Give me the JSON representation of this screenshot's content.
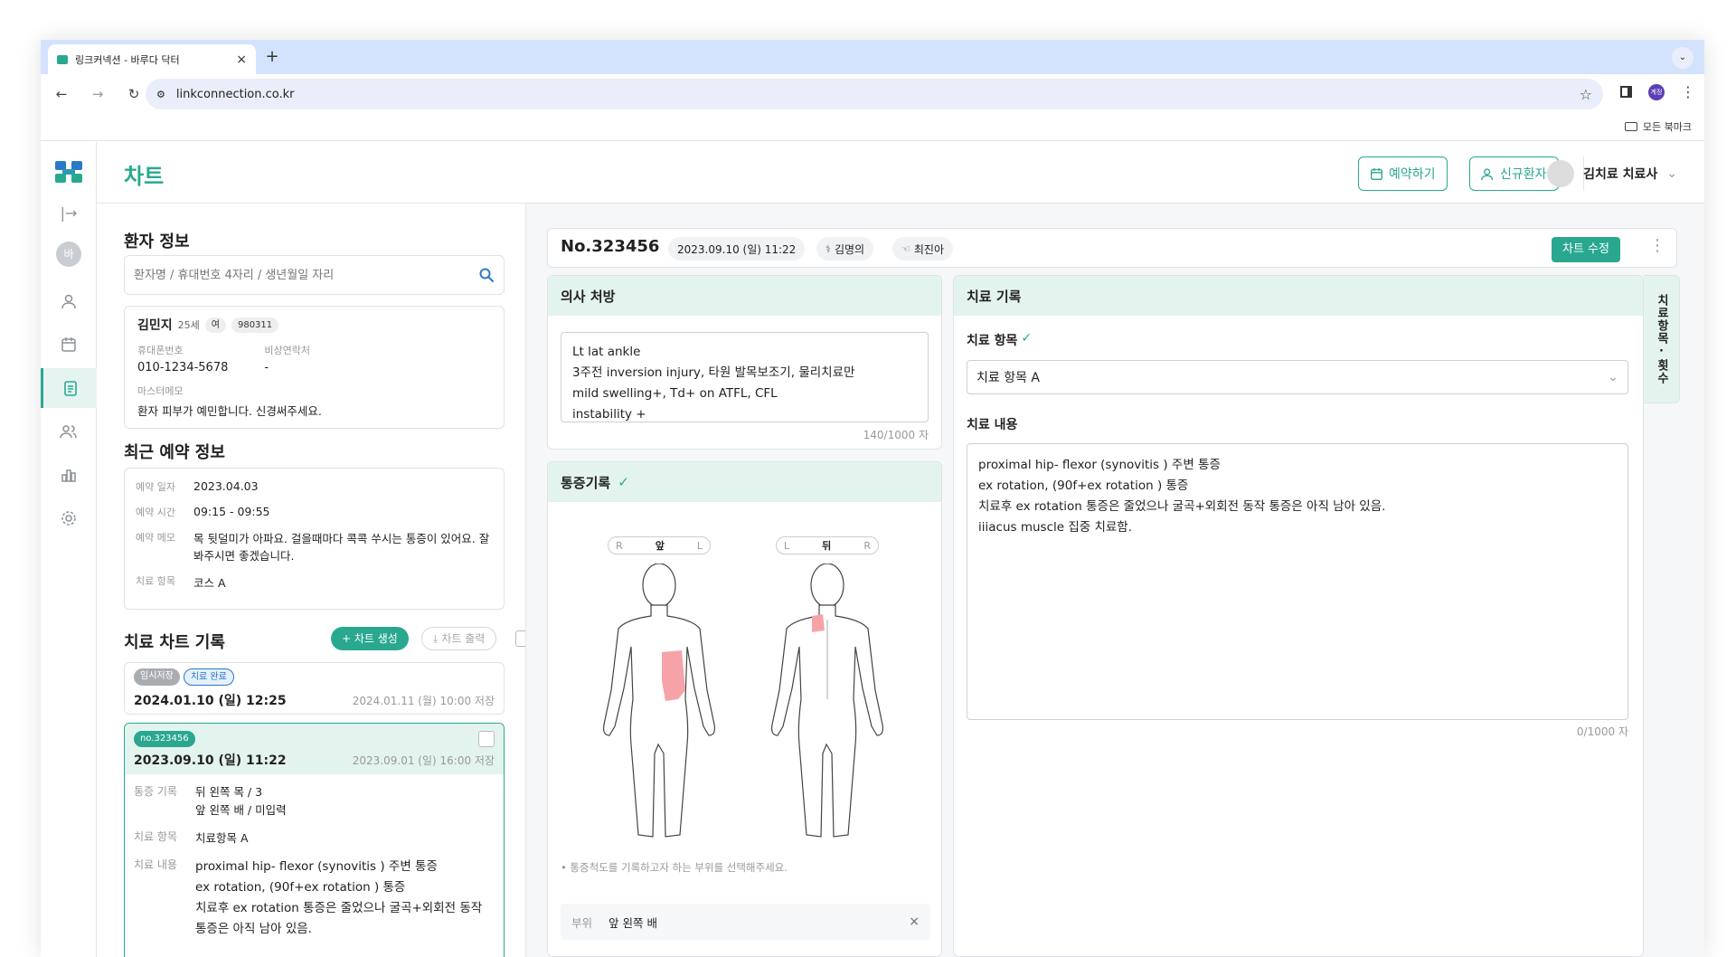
{
  "browser": {
    "tab_title": "링크커넥션 - 바루다 닥터",
    "tab_close": "×",
    "new_tab": "+",
    "url": "linkconnection.co.kr",
    "bookmark_folder": "모든 북마크",
    "profile_label": "계정"
  },
  "app": {
    "page_title": "차트",
    "reserve_button": "예약하기",
    "new_patient_button": "신규환자",
    "user_name": "김치료 치료사",
    "rail_avatar": "바"
  },
  "patient": {
    "section_title": "환자 정보",
    "search_placeholder": "환자명 / 휴대번호 4자리 / 생년월일 자리",
    "name": "김민지",
    "age": "25세",
    "sex": "여",
    "birth": "980311",
    "phone_label": "휴대폰번호",
    "phone": "010-1234-5678",
    "emergency_label": "비상연락처",
    "emergency": "-",
    "memo_label": "마스터메모",
    "memo": "환자 피부가 예민합니다. 신경써주세요."
  },
  "reservation": {
    "section_title": "최근 예약 정보",
    "date_label": "예약 일자",
    "date": "2023.04.03",
    "time_label": "예약 시간",
    "time": "09:15 - 09:55",
    "memo_label": "예약 메모",
    "memo": "목 뒷덜미가 아파요. 걸을때마다 콕콕 쑤시는 통증이 있어요. 잘 봐주시면 좋겠습니다.",
    "item_label": "치료 항목",
    "item": "코스 A"
  },
  "chart_history": {
    "section_title": "치료 차트 기록",
    "create_button": "+ 차트 생성",
    "print_button": "차트 출력",
    "records": [
      {
        "badges": [
          "임시저장",
          "치료 완료"
        ],
        "datetime": "2024.01.10 (일) 12:25",
        "saved": "2024.01.11 (월) 10:00 저장"
      },
      {
        "badges": [
          "no.323456"
        ],
        "datetime": "2023.09.10 (일) 11:22",
        "saved": "2023.09.01 (일) 16:00 저장",
        "pain_label": "통증 기록",
        "pain_lines": [
          "뒤 왼쪽 목 / 3",
          "앞 왼쪽 배 / 미입력"
        ],
        "item_label": "치료 항목",
        "item": "치료항목 A",
        "content_label": "치료 내용",
        "content_lines": [
          "proximal hip- flexor (synovitis ) 주변 통증",
          "ex rotation, (90f+ex rotation ) 통증",
          "치료후 ex rotation 통증은 줄었으나 굴곡+외회전 동작",
          "통증은 아직 남아 있음."
        ]
      }
    ]
  },
  "chart_header": {
    "number": "No.323456",
    "datetime": "2023.09.10 (일) 11:22",
    "doctor": "김명의",
    "therapist": "최진아",
    "edit_button": "차트 수정",
    "more": "⋮"
  },
  "prescription": {
    "title": "의사 처방",
    "lines": [
      "Lt lat ankle",
      "3주전 inversion injury, 타원 발목보조기, 물리치료만",
      "mild swelling+, Td+ on ATFL, CFL",
      "instability +"
    ],
    "counter": "140/1000 자"
  },
  "pain": {
    "title": "통증기록",
    "front_label": "앞",
    "back_label": "뒤",
    "front_left": "R",
    "front_right": "L",
    "back_left": "L",
    "back_right": "R",
    "hint": "• 통증척도를 기록하고자 하는 부위를 선택해주세요.",
    "part_label": "부위",
    "part_value": "앞 왼쪽 배",
    "close": "×",
    "highlight_color": "#f5a3a8"
  },
  "treatment": {
    "title": "치료 기록",
    "item_label": "치료 항목",
    "item_value": "치료 항목 A",
    "content_label": "치료 내용",
    "content_lines": [
      "proximal hip- flexor (synovitis ) 주변 통증",
      "ex rotation, (90f+ex rotation ) 통증",
      "치료후 ex rotation 통증은 줄었으나 굴곡+외회전 동작 통증은 아직 남아 있음.",
      "iiiacus muscle 집중 치료함."
    ],
    "counter": "0/1000 자",
    "side_tab": "치료항목·횟수"
  },
  "colors": {
    "accent": "#29a88f",
    "panel_header": "#e3f4ef",
    "chrome": "#d3e3fd"
  }
}
